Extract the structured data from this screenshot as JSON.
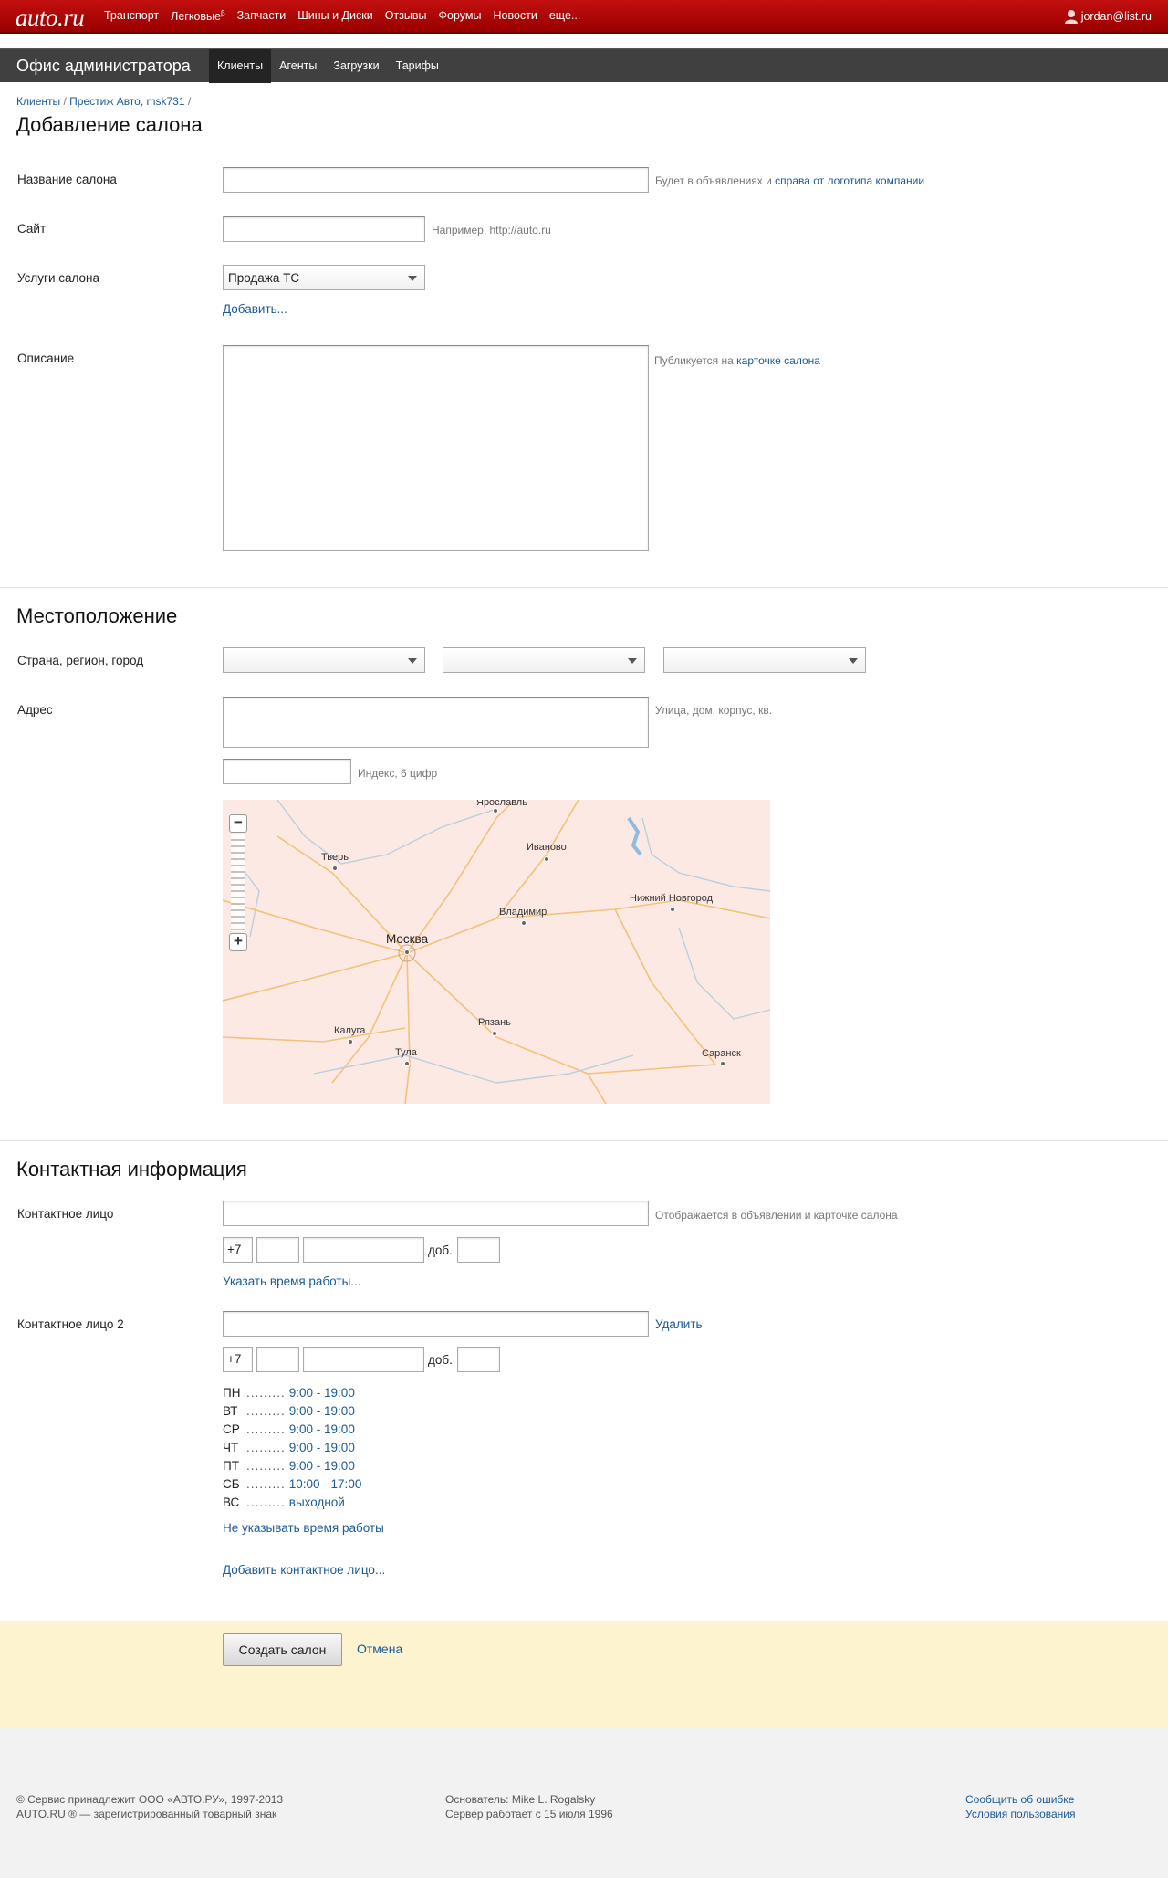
{
  "topbar": {
    "logo": "auto.ru",
    "nav": [
      "Транспорт",
      "Легковые",
      "Запчасти",
      "Шины и Диски",
      "Отзывы",
      "Форумы",
      "Новости",
      "еще..."
    ],
    "nav_sup": "β",
    "user": "jordan@list.ru"
  },
  "adminbar": {
    "title": "Офис администратора",
    "tabs": [
      "Клиенты",
      "Агенты",
      "Загрузки",
      "Тарифы"
    ],
    "active_tab": "Клиенты"
  },
  "breadcrumb": {
    "item1": "Клиенты",
    "sep": "/",
    "item2": "Престиж Авто, msk731"
  },
  "page_title": "Добавление салона",
  "salon": {
    "name_label": "Название салона",
    "name_hint": "Будет в объявлениях и",
    "name_hint_link": "справа от логотипа компании",
    "site_label": "Сайт",
    "site_hint": "Например, http://auto.ru",
    "services_label": "Услуги салона",
    "services_value": "Продажа ТС",
    "add_link": "Добавить...",
    "desc_label": "Описание",
    "desc_hint": "Публикуется на",
    "desc_hint_link": "карточке салона"
  },
  "location": {
    "title": "Местоположение",
    "region_label": "Страна, регион, город",
    "address_label": "Адрес",
    "address_hint": "Улица, дом, корпус, кв.",
    "index_hint": "Индекс, 6 цифр",
    "map_cities": [
      "Ярославль",
      "Тверь",
      "Иваново",
      "Нижний Новгород",
      "Владимир",
      "Москва",
      "Рязань",
      "Калуга",
      "Тула",
      "Саранск"
    ]
  },
  "contacts": {
    "title": "Контактная информация",
    "person1_label": "Контактное лицо",
    "person1_hint": "Отображается в объявлении и карточке салона",
    "phone_prefix": "+7",
    "ext_label": "доб.",
    "work_time_link": "Указать время работы...",
    "person2_label": "Контактное лицо 2",
    "delete_link": "Удалить",
    "schedule": [
      {
        "day": "ПН",
        "hours": "9:00 - 19:00"
      },
      {
        "day": "ВТ",
        "hours": "9:00 - 19:00"
      },
      {
        "day": "СР",
        "hours": "9:00 - 19:00"
      },
      {
        "day": "ЧТ",
        "hours": "9:00 - 19:00"
      },
      {
        "day": "ПТ",
        "hours": "9:00 - 19:00"
      },
      {
        "day": "СБ",
        "hours": "10:00 - 17:00"
      },
      {
        "day": "ВС",
        "hours": "выходной"
      }
    ],
    "schedule_dots": ".........",
    "no_time_link": "Не указывать время работы",
    "add_contact_link": "Добавить контактное лицо..."
  },
  "actions": {
    "create": "Создать салон",
    "cancel": "Отмена"
  },
  "footer": {
    "copyright": "© Сервис принадлежит ООО «АВТО.РУ», 1997-2013",
    "trademark": "AUTO.RU ® — зарегистрированный товарный знак",
    "founder": "Основатель: Mike L. Rogalsky",
    "server": "Сервер работает с 15 июля 1996",
    "report": "Сообщить об ошибке",
    "terms": "Условия пользования"
  }
}
